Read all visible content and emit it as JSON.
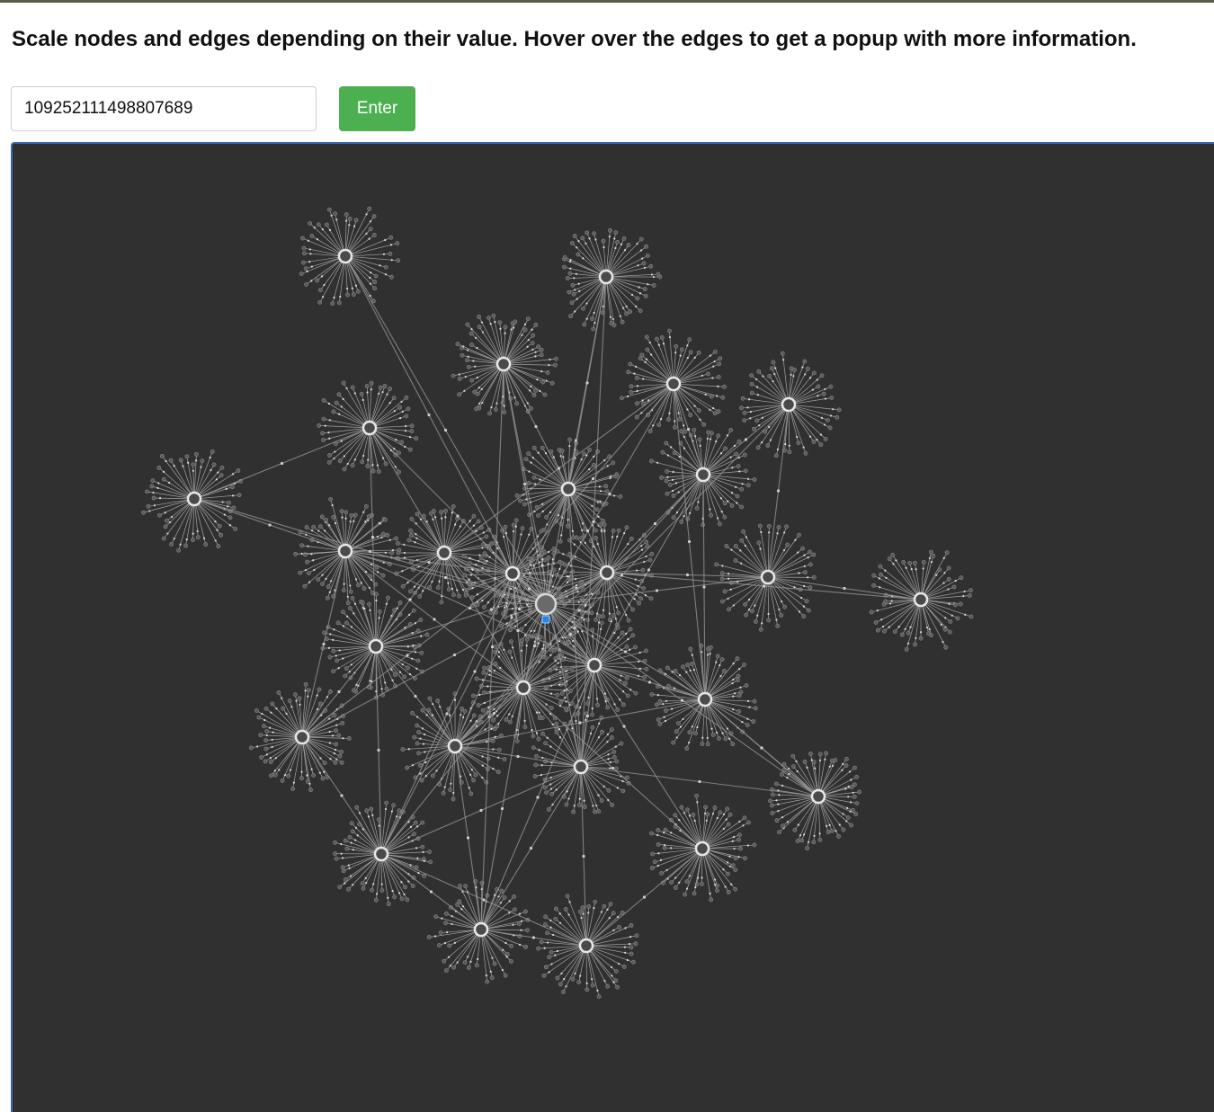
{
  "page": {
    "title": "Scale nodes and edges depending on their value. Hover over the edges to get a popup with more information."
  },
  "search": {
    "value": "109252111498807689"
  },
  "controls": {
    "enter_label": "Enter"
  },
  "colors": {
    "canvas_background": "#303030",
    "button_green": "#4caf50",
    "edge": "#9a9a9a",
    "node": "#e8e8e8",
    "selected_node": "#1e88e5",
    "canvas_border": "#3b6aa8"
  }
}
